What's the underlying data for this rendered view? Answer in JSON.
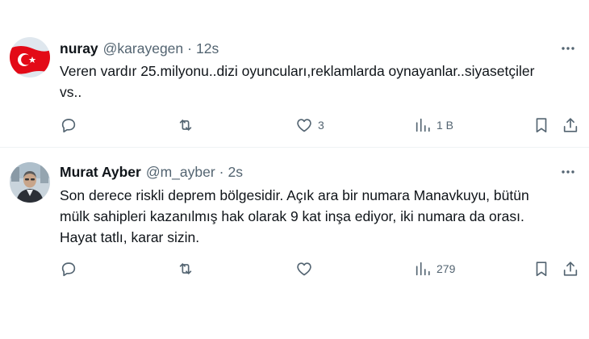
{
  "tweets": [
    {
      "name": "nuray",
      "handle": "@karayegen",
      "separator": "·",
      "time": "12s",
      "text_lines": [
        "Veren vardır 25.milyonu..dizi oyuncuları,reklamlarda oynayanlar..siyasetçiler",
        "vs.."
      ],
      "counts": {
        "reply": "",
        "repost": "",
        "like": "3",
        "views": "1 B"
      },
      "avatar": "turkish-flag-avatar"
    },
    {
      "name": "Murat Ayber",
      "handle": "@m_ayber",
      "separator": "·",
      "time": "2s",
      "text_lines": [
        "Son derece riskli deprem bölgesidir. Açık ara bir numara Manavkuyu, bütün",
        "mülk sahipleri kazanılmış hak olarak 9 kat inşa ediyor, iki numara da orası.",
        "Hayat tatlı, karar sizin."
      ],
      "counts": {
        "reply": "",
        "repost": "",
        "like": "",
        "views": "279"
      },
      "avatar": "man-photo-avatar"
    }
  ],
  "icons": {
    "reply": "reply-icon",
    "repost": "repost-icon",
    "like": "heart-icon",
    "views": "views-icon",
    "bookmark": "bookmark-icon",
    "share": "share-icon",
    "more": "more-icon"
  },
  "colors": {
    "text": "#0f1419",
    "secondary": "#536471",
    "divider": "#eff3f4",
    "flag_red": "#e30a17"
  }
}
